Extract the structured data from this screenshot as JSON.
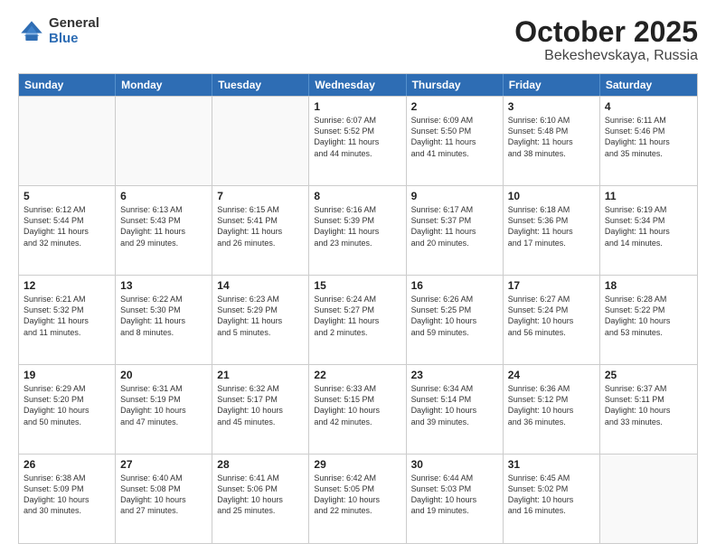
{
  "logo": {
    "general": "General",
    "blue": "Blue"
  },
  "title": "October 2025",
  "subtitle": "Bekeshevskaya, Russia",
  "header_days": [
    "Sunday",
    "Monday",
    "Tuesday",
    "Wednesday",
    "Thursday",
    "Friday",
    "Saturday"
  ],
  "rows": [
    [
      {
        "day": "",
        "info": "",
        "empty": true
      },
      {
        "day": "",
        "info": "",
        "empty": true
      },
      {
        "day": "",
        "info": "",
        "empty": true
      },
      {
        "day": "1",
        "info": "Sunrise: 6:07 AM\nSunset: 5:52 PM\nDaylight: 11 hours\nand 44 minutes."
      },
      {
        "day": "2",
        "info": "Sunrise: 6:09 AM\nSunset: 5:50 PM\nDaylight: 11 hours\nand 41 minutes."
      },
      {
        "day": "3",
        "info": "Sunrise: 6:10 AM\nSunset: 5:48 PM\nDaylight: 11 hours\nand 38 minutes."
      },
      {
        "day": "4",
        "info": "Sunrise: 6:11 AM\nSunset: 5:46 PM\nDaylight: 11 hours\nand 35 minutes."
      }
    ],
    [
      {
        "day": "5",
        "info": "Sunrise: 6:12 AM\nSunset: 5:44 PM\nDaylight: 11 hours\nand 32 minutes."
      },
      {
        "day": "6",
        "info": "Sunrise: 6:13 AM\nSunset: 5:43 PM\nDaylight: 11 hours\nand 29 minutes."
      },
      {
        "day": "7",
        "info": "Sunrise: 6:15 AM\nSunset: 5:41 PM\nDaylight: 11 hours\nand 26 minutes."
      },
      {
        "day": "8",
        "info": "Sunrise: 6:16 AM\nSunset: 5:39 PM\nDaylight: 11 hours\nand 23 minutes."
      },
      {
        "day": "9",
        "info": "Sunrise: 6:17 AM\nSunset: 5:37 PM\nDaylight: 11 hours\nand 20 minutes."
      },
      {
        "day": "10",
        "info": "Sunrise: 6:18 AM\nSunset: 5:36 PM\nDaylight: 11 hours\nand 17 minutes."
      },
      {
        "day": "11",
        "info": "Sunrise: 6:19 AM\nSunset: 5:34 PM\nDaylight: 11 hours\nand 14 minutes."
      }
    ],
    [
      {
        "day": "12",
        "info": "Sunrise: 6:21 AM\nSunset: 5:32 PM\nDaylight: 11 hours\nand 11 minutes."
      },
      {
        "day": "13",
        "info": "Sunrise: 6:22 AM\nSunset: 5:30 PM\nDaylight: 11 hours\nand 8 minutes."
      },
      {
        "day": "14",
        "info": "Sunrise: 6:23 AM\nSunset: 5:29 PM\nDaylight: 11 hours\nand 5 minutes."
      },
      {
        "day": "15",
        "info": "Sunrise: 6:24 AM\nSunset: 5:27 PM\nDaylight: 11 hours\nand 2 minutes."
      },
      {
        "day": "16",
        "info": "Sunrise: 6:26 AM\nSunset: 5:25 PM\nDaylight: 10 hours\nand 59 minutes."
      },
      {
        "day": "17",
        "info": "Sunrise: 6:27 AM\nSunset: 5:24 PM\nDaylight: 10 hours\nand 56 minutes."
      },
      {
        "day": "18",
        "info": "Sunrise: 6:28 AM\nSunset: 5:22 PM\nDaylight: 10 hours\nand 53 minutes."
      }
    ],
    [
      {
        "day": "19",
        "info": "Sunrise: 6:29 AM\nSunset: 5:20 PM\nDaylight: 10 hours\nand 50 minutes."
      },
      {
        "day": "20",
        "info": "Sunrise: 6:31 AM\nSunset: 5:19 PM\nDaylight: 10 hours\nand 47 minutes."
      },
      {
        "day": "21",
        "info": "Sunrise: 6:32 AM\nSunset: 5:17 PM\nDaylight: 10 hours\nand 45 minutes."
      },
      {
        "day": "22",
        "info": "Sunrise: 6:33 AM\nSunset: 5:15 PM\nDaylight: 10 hours\nand 42 minutes."
      },
      {
        "day": "23",
        "info": "Sunrise: 6:34 AM\nSunset: 5:14 PM\nDaylight: 10 hours\nand 39 minutes."
      },
      {
        "day": "24",
        "info": "Sunrise: 6:36 AM\nSunset: 5:12 PM\nDaylight: 10 hours\nand 36 minutes."
      },
      {
        "day": "25",
        "info": "Sunrise: 6:37 AM\nSunset: 5:11 PM\nDaylight: 10 hours\nand 33 minutes."
      }
    ],
    [
      {
        "day": "26",
        "info": "Sunrise: 6:38 AM\nSunset: 5:09 PM\nDaylight: 10 hours\nand 30 minutes."
      },
      {
        "day": "27",
        "info": "Sunrise: 6:40 AM\nSunset: 5:08 PM\nDaylight: 10 hours\nand 27 minutes."
      },
      {
        "day": "28",
        "info": "Sunrise: 6:41 AM\nSunset: 5:06 PM\nDaylight: 10 hours\nand 25 minutes."
      },
      {
        "day": "29",
        "info": "Sunrise: 6:42 AM\nSunset: 5:05 PM\nDaylight: 10 hours\nand 22 minutes."
      },
      {
        "day": "30",
        "info": "Sunrise: 6:44 AM\nSunset: 5:03 PM\nDaylight: 10 hours\nand 19 minutes."
      },
      {
        "day": "31",
        "info": "Sunrise: 6:45 AM\nSunset: 5:02 PM\nDaylight: 10 hours\nand 16 minutes."
      },
      {
        "day": "",
        "info": "",
        "empty": true
      }
    ]
  ]
}
